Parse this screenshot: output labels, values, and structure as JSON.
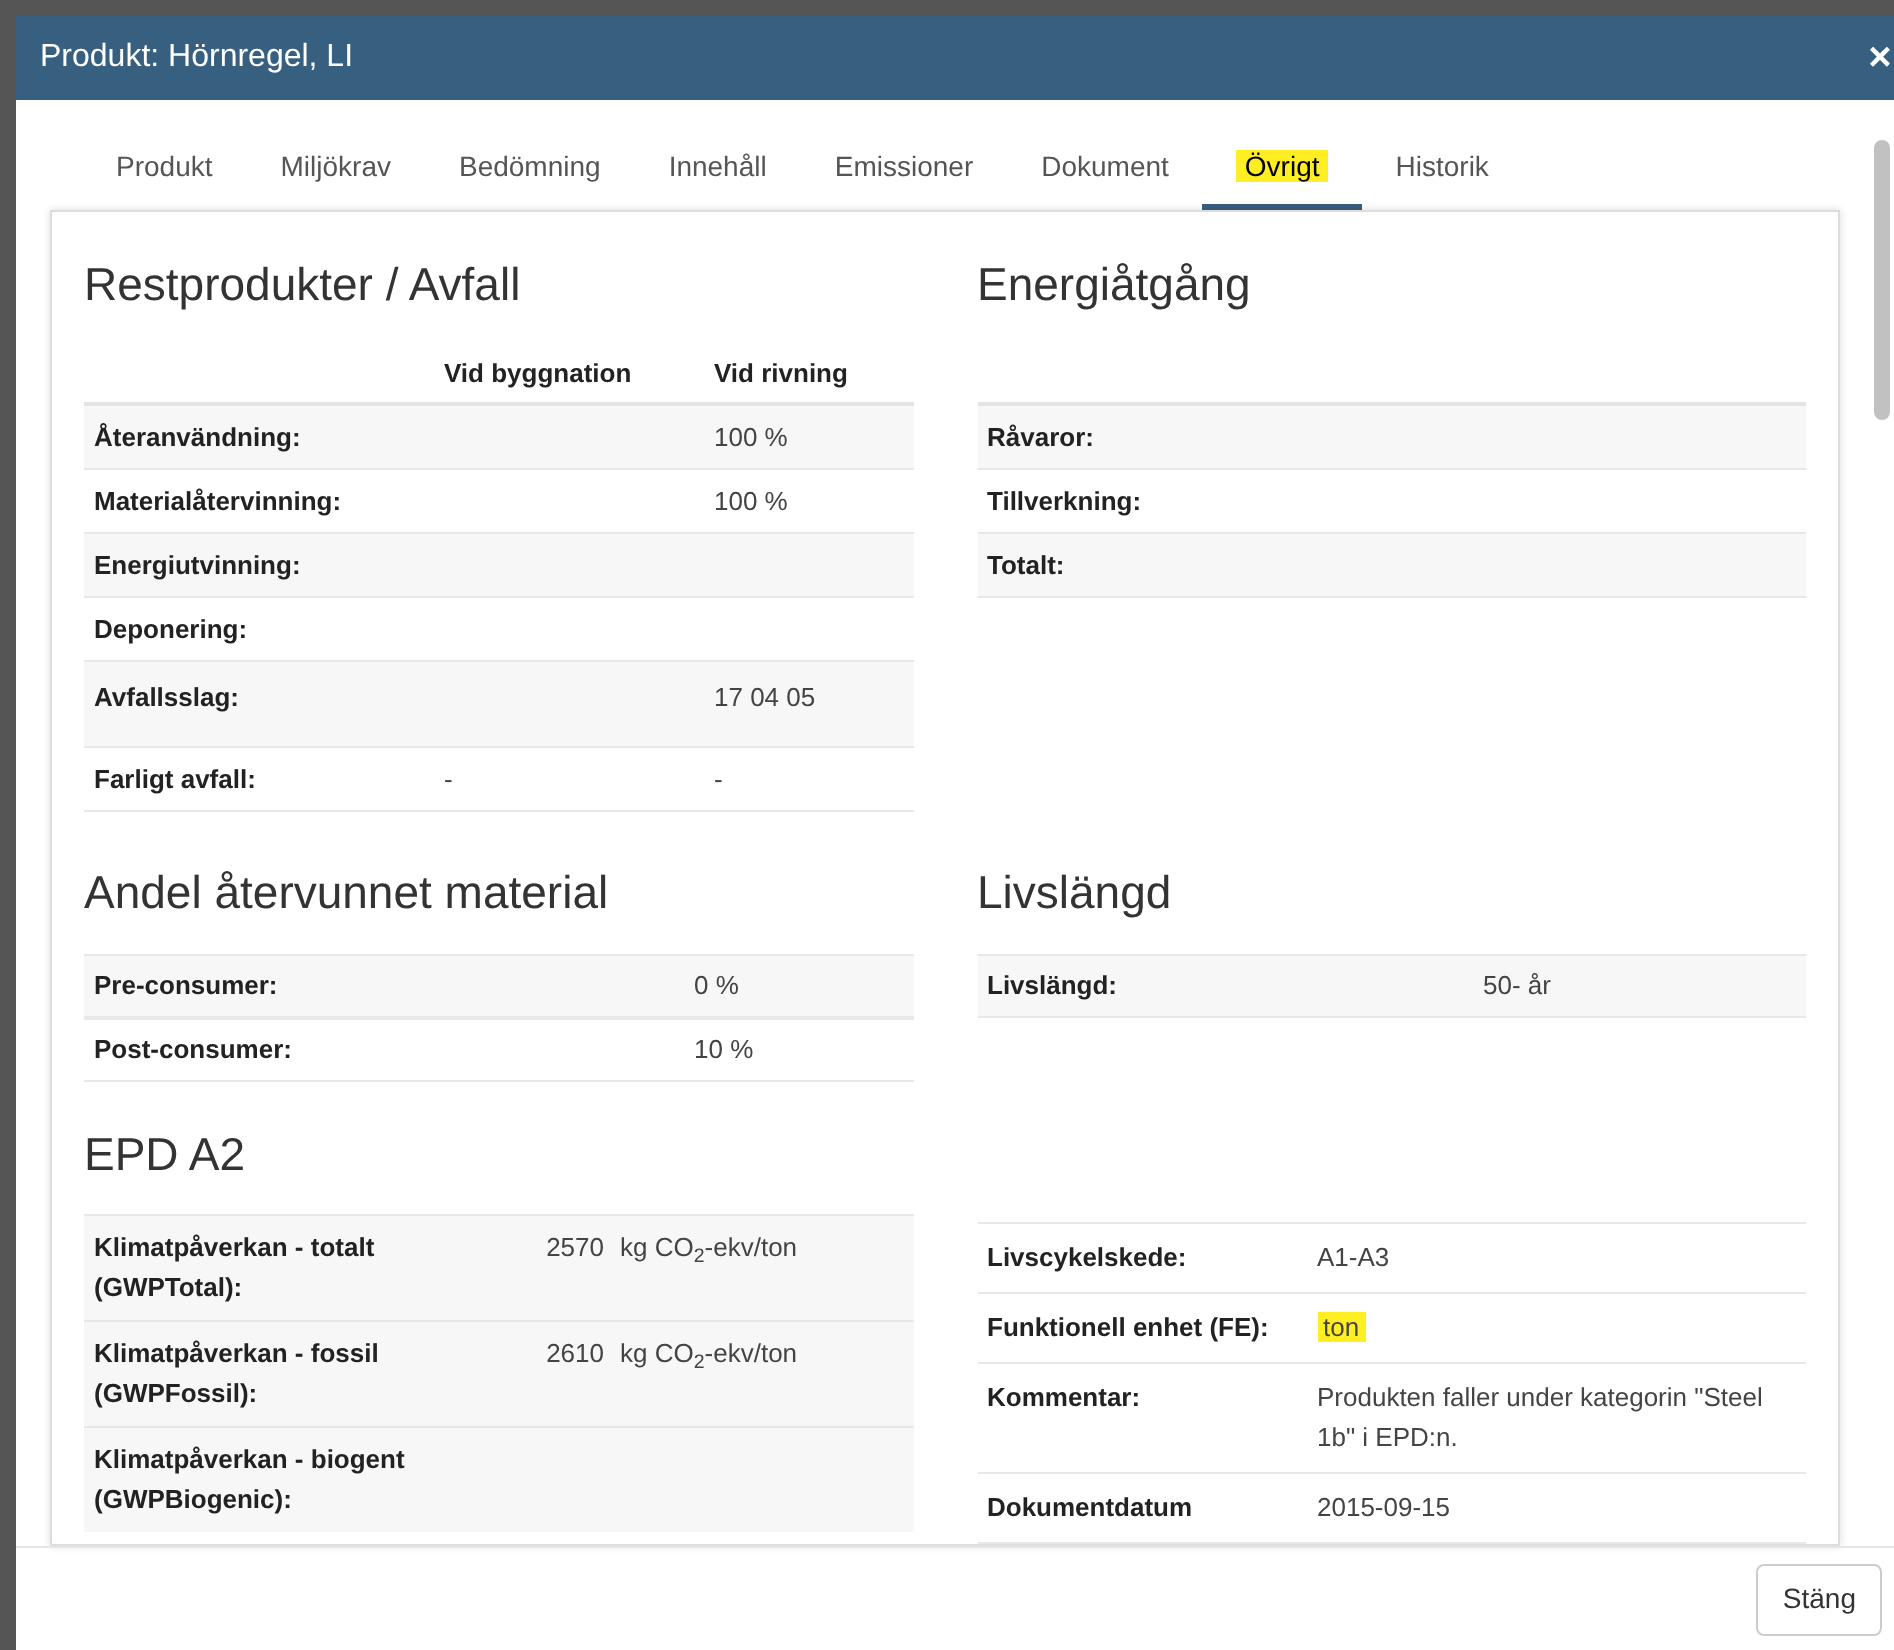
{
  "window": {
    "title": "Produkt: Hörnregel, LI",
    "close": "×"
  },
  "tabs": [
    {
      "label": "Produkt",
      "selected": false,
      "highlighted": false
    },
    {
      "label": "Miljökrav",
      "selected": false,
      "highlighted": false
    },
    {
      "label": "Bedömning",
      "selected": false,
      "highlighted": false
    },
    {
      "label": "Innehåll",
      "selected": false,
      "highlighted": false
    },
    {
      "label": "Emissioner",
      "selected": false,
      "highlighted": false
    },
    {
      "label": "Dokument",
      "selected": false,
      "highlighted": false
    },
    {
      "label": "Övrigt",
      "selected": true,
      "highlighted": true
    },
    {
      "label": "Historik",
      "selected": false,
      "highlighted": false
    }
  ],
  "waste": {
    "title": "Restprodukter / Avfall",
    "columns": [
      "Vid byggnation",
      "Vid rivning"
    ],
    "rows": [
      {
        "label": "Återanvändning:",
        "demolition": "100 %"
      },
      {
        "label": "Materialåtervinning:",
        "demolition": "100 %"
      },
      {
        "label": "Energiutvinning:"
      },
      {
        "label": "Deponering:"
      },
      {
        "label": "Avfallsslag:",
        "demolition": "17 04 05"
      },
      {
        "label": "Farligt avfall:",
        "construction": "-",
        "demolition": "-"
      }
    ]
  },
  "energy": {
    "title": "Energiåtgång",
    "rows": [
      {
        "label": "Råvaror:"
      },
      {
        "label": "Tillverkning:"
      },
      {
        "label": "Totalt:"
      }
    ]
  },
  "recycled": {
    "title": "Andel återvunnet material",
    "rows": [
      {
        "label": "Pre-consumer:",
        "value": "0 %"
      },
      {
        "label": "Post-consumer:",
        "value": "10 %"
      }
    ]
  },
  "lifespan": {
    "title": "Livslängd",
    "rows": [
      {
        "label": "Livslängd:",
        "value": "50- år"
      }
    ]
  },
  "epd": {
    "title": "EPD A2",
    "impacts": [
      {
        "label": "Klimatpåverkan - totalt (GWPTotal):",
        "value": "2570",
        "unit": "kg CO$_{2}$-ekv/ton"
      },
      {
        "label": "Klimatpåverkan - fossil (GWPFossil):",
        "value": "2610",
        "unit": "kg CO$_{2}$-ekv/ton"
      },
      {
        "label": "Klimatpåverkan - biogent (GWPBiogenic):"
      }
    ],
    "info": [
      {
        "label": "Livscykelskede:",
        "value": "A1-A3",
        "highlighted": false
      },
      {
        "label": "Funktionell enhet (FE):",
        "value": "ton",
        "highlighted": true
      },
      {
        "label": "Kommentar:",
        "value": "Produkten faller under kategorin \"Steel 1b\" i EPD:n.",
        "highlighted": false
      },
      {
        "label": "Dokumentdatum",
        "value": "2015-09-15",
        "highlighted": false
      }
    ]
  },
  "footer": {
    "close_button": "Stäng"
  }
}
